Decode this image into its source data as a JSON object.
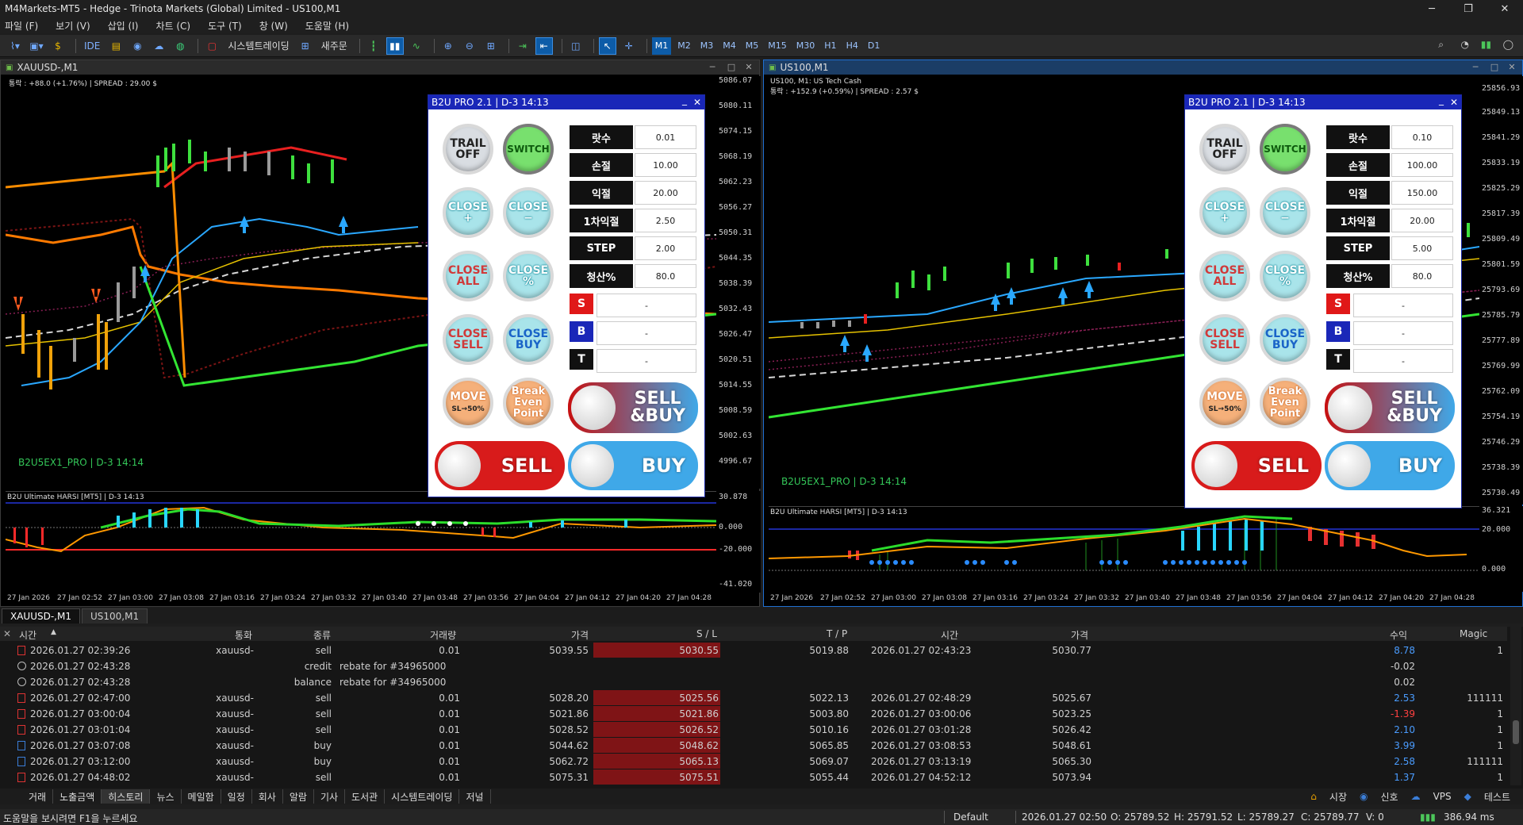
{
  "window": {
    "title": "M4Markets-MT5 - Hedge - Trinota Markets (Global) Limited - US100,M1",
    "ctrl_min": "─",
    "ctrl_max": "❐",
    "ctrl_close": "✕"
  },
  "menu": [
    "파일 (F)",
    "보기 (V)",
    "삽입 (I)",
    "차트 (C)",
    "도구 (T)",
    "창 (W)",
    "도움말 (H)"
  ],
  "toolbar": {
    "ide": "IDE",
    "algo": "시스템트레이딩",
    "new_order": "새주문",
    "timeframes": [
      "M1",
      "M2",
      "M3",
      "M4",
      "M5",
      "M15",
      "M30",
      "H1",
      "H4",
      "D1"
    ],
    "active_tf": "M1"
  },
  "charts": [
    {
      "title": "XAUUSD-,M1",
      "info": "통락 : +88.0 (+1.76%) | SPREAD : 29.00 $",
      "indicator_label": "B2U5EX1_PRO | D-3 14:14",
      "sub_label": "B2U Ultimate HARSI [MT5] | D-3 14:13",
      "price_ticks": [
        "5086.07",
        "5080.11",
        "5074.15",
        "5068.19",
        "5062.23",
        "5056.27",
        "5050.31",
        "5044.35",
        "5038.39",
        "5032.43",
        "5026.47",
        "5020.51",
        "5014.55",
        "5008.59",
        "5002.63",
        "4996.67"
      ],
      "sub_ticks": [
        "30.878",
        "0.000",
        "-20.000",
        "-41.020"
      ],
      "time_ticks": [
        "27 Jan 2026",
        "27 Jan 02:52",
        "27 Jan 03:00",
        "27 Jan 03:08",
        "27 Jan 03:16",
        "27 Jan 03:24",
        "27 Jan 03:32",
        "27 Jan 03:40",
        "27 Jan 03:48",
        "27 Jan 03:56",
        "27 Jan 04:04",
        "27 Jan 04:12",
        "27 Jan 04:20",
        "27 Jan 04:28"
      ],
      "ea": {
        "title": "B2U PRO 2.1  |  D-3 14:13",
        "lot": "0.01",
        "sl": "10.00",
        "tp": "20.00",
        "tp1": "2.50",
        "step": "2.00",
        "close_pct": "80.0",
        "s": "-",
        "b": "-",
        "t": "-"
      }
    },
    {
      "title": "US100,M1",
      "info": "US100, M1:  US Tech Cash",
      "info2": "통락 : +152.9 (+0.59%) | SPREAD : 2.57 $",
      "indicator_label": "B2U5EX1_PRO | D-3 14:14",
      "sub_label": "B2U Ultimate HARSI [MT5] | D-3 14:13",
      "price_ticks": [
        "25856.93",
        "25849.13",
        "25841.29",
        "25833.19",
        "25825.29",
        "25817.39",
        "25809.49",
        "25801.59",
        "25793.69",
        "25785.79",
        "25777.89",
        "25769.99",
        "25762.09",
        "25754.19",
        "25746.29",
        "25738.39",
        "25730.49"
      ],
      "sub_ticks": [
        "36.321",
        "20.000",
        "0.000"
      ],
      "time_ticks": [
        "27 Jan 2026",
        "27 Jan 02:52",
        "27 Jan 03:00",
        "27 Jan 03:08",
        "27 Jan 03:16",
        "27 Jan 03:24",
        "27 Jan 03:32",
        "27 Jan 03:40",
        "27 Jan 03:48",
        "27 Jan 03:56",
        "27 Jan 04:04",
        "27 Jan 04:12",
        "27 Jan 04:20",
        "27 Jan 04:28"
      ],
      "ea": {
        "title": "B2U PRO 2.1  |  D-3 14:13",
        "lot": "0.10",
        "sl": "100.00",
        "tp": "150.00",
        "tp1": "20.00",
        "step": "5.00",
        "close_pct": "80.0",
        "s": "-",
        "b": "-",
        "t": "-"
      }
    }
  ],
  "ea_labels": {
    "lot": "랏수",
    "sl": "손절",
    "tp": "익절",
    "tp1": "1차익절",
    "step": "STEP",
    "close_pct": "청산%",
    "s": "S",
    "b": "B",
    "t": "T"
  },
  "ea_buttons": {
    "trail_off": [
      "TRAIL",
      "OFF"
    ],
    "switch": "SWITCH",
    "close_plus": [
      "CLOSE",
      "+"
    ],
    "close_minus": [
      "CLOSE",
      "−"
    ],
    "close_all": [
      "CLOSE",
      "ALL"
    ],
    "close_pct": [
      "CLOSE",
      "%"
    ],
    "close_sell": [
      "CLOSE",
      "SELL"
    ],
    "close_buy": [
      "CLOSE",
      "BUY"
    ],
    "move": [
      "MOVE",
      "SL→50%"
    ],
    "be": [
      "Break",
      "Even",
      "Point"
    ],
    "sellbuy": [
      "SELL",
      "&BUY"
    ],
    "sell": "SELL",
    "buy": "BUY"
  },
  "chart_tabs": [
    "XAUUSD-,M1",
    "US100,M1"
  ],
  "history": {
    "headers": [
      "시간",
      "통화",
      "종류",
      "거래량",
      "가격",
      "S / L",
      "T / P",
      "시간",
      "가격",
      "수익",
      "Magic"
    ],
    "rows": [
      {
        "kind": "s",
        "time": "2026.01.27 02:39:26",
        "sym": "xauusd-",
        "type": "sell",
        "vol": "0.01",
        "price": "5039.55",
        "sl": "5030.55",
        "tp": "5019.88",
        "ctime": "2026.01.27 02:43:23",
        "cprice": "5030.77",
        "profit": "8.78",
        "magic": "1"
      },
      {
        "kind": "c",
        "time": "2026.01.27 02:43:28",
        "sym": "",
        "type": "credit",
        "comment": "rebate for #34965000",
        "profit": "-0.02"
      },
      {
        "kind": "c",
        "time": "2026.01.27 02:43:28",
        "sym": "",
        "type": "balance",
        "comment": "rebate for #34965000",
        "profit": "0.02"
      },
      {
        "kind": "s",
        "time": "2026.01.27 02:47:00",
        "sym": "xauusd-",
        "type": "sell",
        "vol": "0.01",
        "price": "5028.20",
        "sl": "5025.56",
        "tp": "5022.13",
        "ctime": "2026.01.27 02:48:29",
        "cprice": "5025.67",
        "profit": "2.53",
        "magic": "111111"
      },
      {
        "kind": "s",
        "time": "2026.01.27 03:00:04",
        "sym": "xauusd-",
        "type": "sell",
        "vol": "0.01",
        "price": "5021.86",
        "sl": "5021.86",
        "tp": "5003.80",
        "ctime": "2026.01.27 03:00:06",
        "cprice": "5023.25",
        "profit": "-1.39",
        "magic": "1"
      },
      {
        "kind": "s",
        "time": "2026.01.27 03:01:04",
        "sym": "xauusd-",
        "type": "sell",
        "vol": "0.01",
        "price": "5028.52",
        "sl": "5026.52",
        "tp": "5010.16",
        "ctime": "2026.01.27 03:01:28",
        "cprice": "5026.42",
        "profit": "2.10",
        "magic": "1"
      },
      {
        "kind": "b",
        "time": "2026.01.27 03:07:08",
        "sym": "xauusd-",
        "type": "buy",
        "vol": "0.01",
        "price": "5044.62",
        "sl": "5048.62",
        "tp": "5065.85",
        "ctime": "2026.01.27 03:08:53",
        "cprice": "5048.61",
        "profit": "3.99",
        "magic": "1"
      },
      {
        "kind": "b",
        "time": "2026.01.27 03:12:00",
        "sym": "xauusd-",
        "type": "buy",
        "vol": "0.01",
        "price": "5062.72",
        "sl": "5065.13",
        "tp": "5069.07",
        "ctime": "2026.01.27 03:13:19",
        "cprice": "5065.30",
        "profit": "2.58",
        "magic": "111111"
      },
      {
        "kind": "s",
        "time": "2026.01.27 04:48:02",
        "sym": "xauusd-",
        "type": "sell",
        "vol": "0.01",
        "price": "5075.31",
        "sl": "5075.51",
        "tp": "5055.44",
        "ctime": "2026.01.27 04:52:12",
        "cprice": "5073.94",
        "profit": "1.37",
        "magic": "1"
      }
    ]
  },
  "bottom_tabs": [
    "거래",
    "노출금액",
    "히스토리",
    "뉴스",
    "메일함",
    "일정",
    "회사",
    "알람",
    "기사",
    "도서관",
    "시스템트레이딩",
    "저널"
  ],
  "bottom_right": [
    "시장",
    "신호",
    "VPS",
    "테스트"
  ],
  "status": {
    "help": "도움말을 보시려면 F1을 누르세요",
    "profile": "Default",
    "datetime": "2026.01.27 02:50",
    "o": "O: 25789.52",
    "h": "H: 25791.52",
    "l": "L: 25789.27",
    "c": "C: 25789.77",
    "v": "V: 0",
    "net": "386.94 ms"
  },
  "colors": {
    "sell_btn": "#d81b1b",
    "buy_btn": "#3fa8e8",
    "accent": "#0d5ca8"
  }
}
